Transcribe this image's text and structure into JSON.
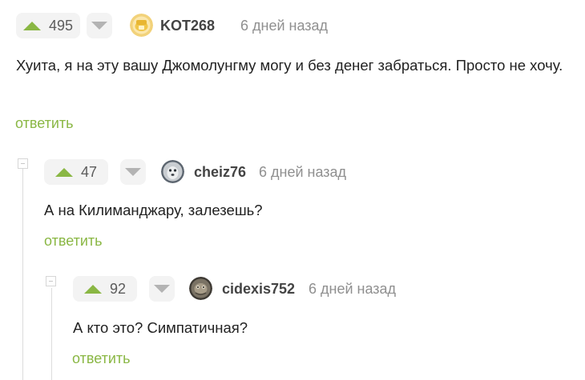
{
  "comments": [
    {
      "rating": "495",
      "author": "KOT268",
      "time": "6 дней назад",
      "text": "Хуита, я на эту вашу Джомолунгму могу и без денег забраться. Просто не хочу.",
      "reply": "ответить"
    },
    {
      "rating": "47",
      "author": "cheiz76",
      "time": "6 дней назад",
      "text": "А на Килиманджару, залезешь?",
      "reply": "ответить"
    },
    {
      "rating": "92",
      "author": "cidexis752",
      "time": "6 дней назад",
      "text": "А кто это? Симпатичная?",
      "reply": "ответить"
    }
  ],
  "colors": {
    "upvote": "#8ab744",
    "reply_link": "#8ab744",
    "vote_bg": "#f3f3f3",
    "time_text": "#8f8f8f"
  },
  "icons": {
    "upvote": "triangle-up-icon",
    "downvote": "triangle-down-icon",
    "collapse": "minus-square-icon"
  }
}
